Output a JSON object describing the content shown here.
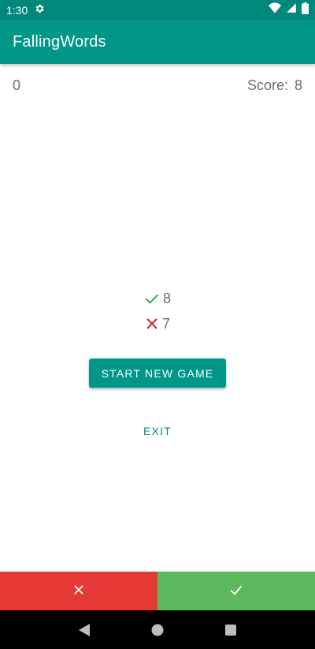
{
  "status_bar": {
    "time": "1:30",
    "settings_icon": "gear-icon",
    "wifi_icon": "wifi-icon",
    "signal_icon": "signal-icon",
    "battery_icon": "battery-icon"
  },
  "app_bar": {
    "title": "FallingWords"
  },
  "game": {
    "counter": "0",
    "score_label": "Score:",
    "score_value": "8"
  },
  "results": {
    "correct_icon": "check-icon",
    "correct_count": "8",
    "wrong_icon": "close-icon",
    "wrong_count": "7"
  },
  "actions": {
    "start_label": "START NEW GAME",
    "exit_label": "EXIT"
  },
  "answer_buttons": {
    "wrong_icon": "close-icon",
    "right_icon": "check-icon"
  },
  "nav_bar": {
    "back_icon": "back-triangle-icon",
    "home_icon": "home-circle-icon",
    "recents_icon": "recents-square-icon"
  },
  "colors": {
    "primary": "#009688",
    "primary_dark": "#00897b",
    "correct": "#4caf50",
    "wrong": "#c62828",
    "answer_wrong_bg": "#e53935",
    "answer_right_bg": "#5cb85c"
  }
}
